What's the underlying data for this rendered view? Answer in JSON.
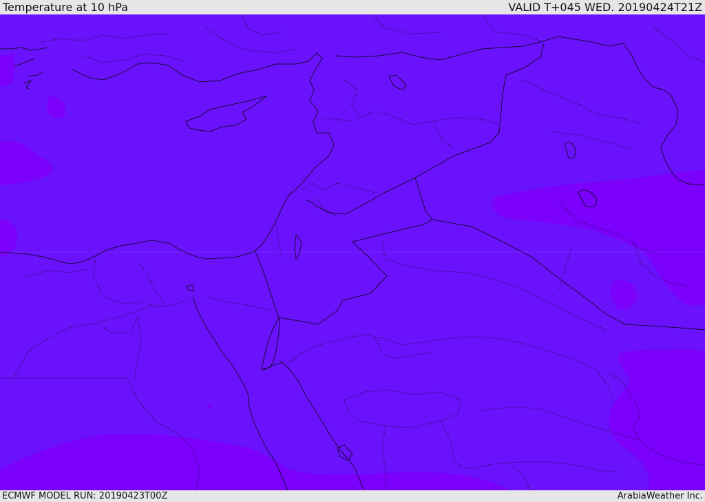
{
  "header": {
    "title": "Temperature at 10 hPa",
    "valid": "VALID T+045 WED. 20190424T21Z"
  },
  "footer": {
    "model_run": "ECMWF MODEL RUN: 20190423T00Z",
    "credit": "ArabiaWeather Inc."
  },
  "colors": {
    "base_fill": "#6a12fb",
    "warm_fill": "#7b00fc",
    "coast_line": "#1a0a3c",
    "frame_bg": "#e6e6e6"
  }
}
